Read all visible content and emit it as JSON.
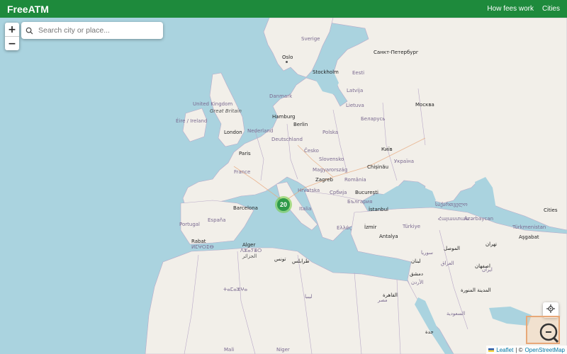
{
  "header": {
    "brand": "FreeATM",
    "nav": [
      "How fees work",
      "Cities"
    ]
  },
  "search": {
    "placeholder": "Search city or place..."
  },
  "zoom": {
    "in": "+",
    "out": "−"
  },
  "cluster": {
    "count": "20"
  },
  "attribution": {
    "leaflet": "Leaflet",
    "sep": "| ©",
    "osm": "OpenStreetMap"
  },
  "labels": {
    "sverige": "Sverige",
    "oslo": "Oslo",
    "stockholm": "Stockholm",
    "spb": "Санкт-Петербург",
    "eesti": "Eesti",
    "latvija": "Latvija",
    "lietuva": "Lietuva",
    "danmark": "Danmark",
    "uk": "United Kingdom",
    "gb": "Great Britain",
    "eire": "Éire / Ireland",
    "london": "London",
    "hamburg": "Hamburg",
    "berlin": "Berlin",
    "nederland": "Nederland",
    "deutschland": "Deutschland",
    "polska": "Polska",
    "belarus": "Беларусь",
    "moskva": "Москва",
    "paris": "Paris",
    "cesko": "Česko",
    "kyiv": "Київ",
    "ukraina": "Україна",
    "france": "France",
    "slovensko": "Slovensko",
    "magyar": "Magyarország",
    "chisinau": "Chișinău",
    "zagreb": "Zagreb",
    "romania": "România",
    "hrvatska": "Hrvatska",
    "srbija": "Србија",
    "bucuresti": "București",
    "italia": "Italia",
    "bulgaria": "България",
    "barcelona": "Barcelona",
    "istanbul": "İstanbul",
    "georgia": "საქართველო",
    "portugal": "Portugal",
    "espana": "España",
    "hellas": "Ελλάς",
    "izmir": "İzmir",
    "turkiye": "Türkiye",
    "armenia": "Հայաստան",
    "azerbaycan": "Azərbaycan",
    "iran": "ایران",
    "cities": "Cities",
    "turkmenistan": "Türkmenistan",
    "ashgabat": "Aşgabat",
    "antalya": "Antalya",
    "rabat": "Rabat",
    "morocco": "ⵍⵎⵖⵔⵉⴱ",
    "alger": "Alger",
    "algeria": "ⴷⵣⴰⵢⴻⵔ",
    "jazair": "الجزائر",
    "tunis": "تونس",
    "tarabulus": "طرابلس",
    "syria": "سوريا",
    "dimashq": "دمشق",
    "iraq": "العراق",
    "mosul": "الموصل",
    "tehran": "تهران",
    "esfahan": "اصفهان",
    "urdun": "الأردن",
    "qahira": "القاهرة",
    "misr": "مصر",
    "madina": "المدينة المنورة",
    "saudi": "السعودية",
    "libya": "ليبيا",
    "tamazgha": "ⵜⴰⵎⴰⵣⵖⴰ",
    "mali": "Mali",
    "niger": "Niger",
    "lebanon": "لبنان",
    "jeddah": "جدة"
  }
}
